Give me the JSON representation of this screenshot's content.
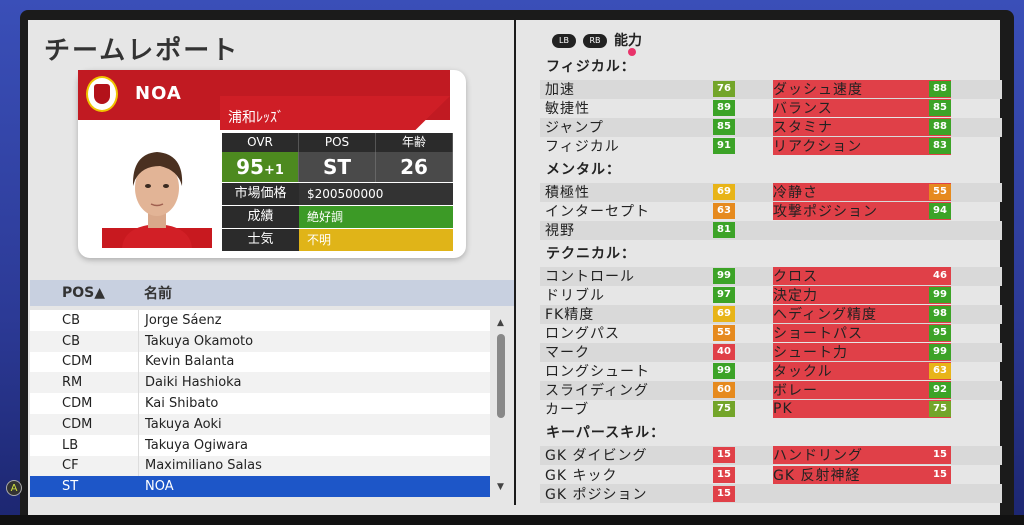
{
  "page_title": "チームレポート",
  "player": {
    "name": "NOA",
    "club": "浦和ﾚｯｽﾞ",
    "headers": [
      "OVR",
      "POS",
      "年齢"
    ],
    "ovr": "95",
    "ovr_bonus": "+1",
    "pos": "ST",
    "age": "26",
    "market_label": "市場価格",
    "market_value": "$200500000",
    "form_label": "成績",
    "form_value": "絶好調",
    "morale_label": "士気",
    "morale_value": "不明"
  },
  "list": {
    "col_pos": "POS▲",
    "col_name": "名前",
    "a_button": "A",
    "rows": [
      {
        "pos": "CB",
        "name": "Jorge Sáenz"
      },
      {
        "pos": "CB",
        "name": "Takuya Okamoto"
      },
      {
        "pos": "CDM",
        "name": "Kevin Balanta"
      },
      {
        "pos": "RM",
        "name": "Daiki Hashioka"
      },
      {
        "pos": "CDM",
        "name": "Kai Shibato"
      },
      {
        "pos": "CDM",
        "name": "Takuya Aoki"
      },
      {
        "pos": "LB",
        "name": "Takuya Ogiwara"
      },
      {
        "pos": "CF",
        "name": "Maximiliano Salas"
      },
      {
        "pos": "ST",
        "name": "NOA"
      }
    ]
  },
  "tabs": {
    "lb": "LB",
    "rb": "RB",
    "active": "能力"
  },
  "sections": {
    "physical": "フィジカル：",
    "mental": "メンタル：",
    "technical": "テクニカル：",
    "goalkeeping": "キーパースキル："
  },
  "attributes": {
    "physical": [
      {
        "name": "加速",
        "value": "76",
        "color": "lg"
      },
      {
        "name": "ダッシュ速度",
        "value": "88",
        "color": "g"
      },
      {
        "name": "敏捷性",
        "value": "89",
        "color": "g"
      },
      {
        "name": "バランス",
        "value": "85",
        "color": "g"
      },
      {
        "name": "ジャンプ",
        "value": "85",
        "color": "g"
      },
      {
        "name": "スタミナ",
        "value": "88",
        "color": "g"
      },
      {
        "name": "フィジカル",
        "value": "91",
        "color": "g"
      },
      {
        "name": "リアクション",
        "value": "83",
        "color": "g"
      }
    ],
    "mental": [
      {
        "name": "積極性",
        "value": "69",
        "color": "y"
      },
      {
        "name": "冷静さ",
        "value": "55",
        "color": "o"
      },
      {
        "name": "インターセプト",
        "value": "63",
        "color": "o"
      },
      {
        "name": "攻撃ポジション",
        "value": "94",
        "color": "g"
      },
      {
        "name": "視野",
        "value": "81",
        "color": "g"
      }
    ],
    "technical": [
      {
        "name": "コントロール",
        "value": "99",
        "color": "g"
      },
      {
        "name": "クロス",
        "value": "46",
        "color": "r"
      },
      {
        "name": "ドリブル",
        "value": "97",
        "color": "g"
      },
      {
        "name": "決定力",
        "value": "99",
        "color": "g"
      },
      {
        "name": "FK精度",
        "value": "69",
        "color": "y"
      },
      {
        "name": "ヘディング精度",
        "value": "98",
        "color": "g"
      },
      {
        "name": "ロングパス",
        "value": "55",
        "color": "o"
      },
      {
        "name": "ショートパス",
        "value": "95",
        "color": "g"
      },
      {
        "name": "マーク",
        "value": "40",
        "color": "r"
      },
      {
        "name": "シュート力",
        "value": "99",
        "color": "g"
      },
      {
        "name": "ロングシュート",
        "value": "99",
        "color": "g"
      },
      {
        "name": "タックル",
        "value": "63",
        "color": "y"
      },
      {
        "name": "スライディング",
        "value": "60",
        "color": "o"
      },
      {
        "name": "ボレー",
        "value": "92",
        "color": "g"
      },
      {
        "name": "カーブ",
        "value": "75",
        "color": "lg"
      },
      {
        "name": "PK",
        "value": "75",
        "color": "lg"
      }
    ],
    "goalkeeping": [
      {
        "name": "GK ダイビング",
        "value": "15",
        "color": "r"
      },
      {
        "name": "ハンドリング",
        "value": "15",
        "color": "r"
      },
      {
        "name": "GK キック",
        "value": "15",
        "color": "r"
      },
      {
        "name": "GK 反射神経",
        "value": "15",
        "color": "r"
      },
      {
        "name": "GK ポジション",
        "value": "15",
        "color": "r"
      }
    ]
  }
}
